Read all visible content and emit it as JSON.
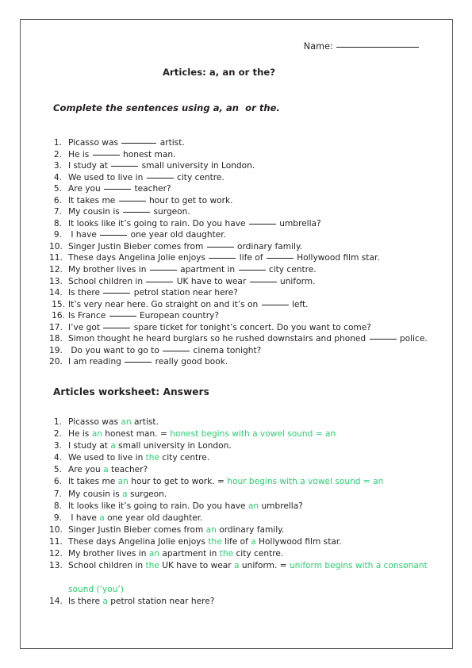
{
  "header": {
    "name_label": "Name:",
    "title": "Articles: a, an or the?",
    "instruction": "Complete the sentences using a, an  or the."
  },
  "questions": {
    "items": [
      {
        "num": "1.",
        "pre": "Picasso was ",
        "blank": "w1",
        "post": " artist."
      },
      {
        "num": "2.",
        "pre": "He is ",
        "blank": "w2",
        "post": " honest man."
      },
      {
        "num": "3.",
        "pre": "I study at ",
        "blank": "w2",
        "post": " small university in London."
      },
      {
        "num": "4.",
        "pre": "We used to live in ",
        "blank": "w2",
        "post": " city centre."
      },
      {
        "num": "5.",
        "pre": "Are you ",
        "blank": "w2",
        "post": " teacher?"
      },
      {
        "num": "6.",
        "pre": "It takes me ",
        "blank": "w2",
        "post": " hour to get to work."
      },
      {
        "num": "7.",
        "pre": "My cousin is ",
        "blank": "w2",
        "post": " surgeon."
      },
      {
        "num": "8.",
        "pre": "It looks like it’s going to rain. Do you have ",
        "blank": "w2",
        "post": " umbrella?"
      },
      {
        "num": "9.",
        "pre": " I have ",
        "blank": "w2",
        "post": " one year old daughter."
      },
      {
        "num": "10.",
        "pre": "Singer Justin Bieber comes from ",
        "blank": "w2",
        "post": " ordinary family."
      },
      {
        "num": "11.",
        "pre": "These days Angelina Jolie enjoys ",
        "blank": "w2",
        "mid": " life of ",
        "blank2": "w2",
        "post": " Hollywood film star."
      },
      {
        "num": "12.",
        "pre": "My brother lives in ",
        "blank": "w2",
        "mid": " apartment in ",
        "blank2": "w2",
        "post": " city centre."
      },
      {
        "num": "13.",
        "pre": "School children in ",
        "blank": "w2",
        "mid": " UK have to wear ",
        "blank2": "w2",
        "post": " uniform."
      },
      {
        "num": "14.",
        "pre": "Is there ",
        "blank": "w2",
        "post": " petrol station near here?"
      },
      {
        "num": "15.",
        "pre": "It’s very near here. Go straight on and it’s on ",
        "blank": "w2",
        "post": " left."
      },
      {
        "num": "16.",
        "pre": "Is France ",
        "blank": "w2",
        "post": " European country?"
      },
      {
        "num": "17.",
        "pre": "I’ve got ",
        "blank": "w2",
        "post": " spare ticket for tonight’s concert. Do you want to come?"
      },
      {
        "num": "18.",
        "pre": "Simon thought he heard burglars so he rushed downstairs and phoned ",
        "blank": "w2",
        "post": " police."
      },
      {
        "num": "19.",
        "pre": " Do you want to go to ",
        "blank": "w2",
        "post": " cinema tonight?"
      },
      {
        "num": "20.",
        "pre": "I am reading ",
        "blank": "w2",
        "post": " really good book."
      }
    ]
  },
  "answers": {
    "title": "Articles worksheet: Answers",
    "items": [
      {
        "num": "1.",
        "pre": "Picasso was ",
        "ans": "an",
        "post": " artist.",
        "note": ""
      },
      {
        "num": "2.",
        "pre": "He is ",
        "ans": "an",
        "post": " honest man. = ",
        "note": "honest begins with a vowel sound = an"
      },
      {
        "num": "3.",
        "pre": "I study at ",
        "ans": "a",
        "post": " small university in London.",
        "note": ""
      },
      {
        "num": "4.",
        "pre": "We used to live in ",
        "ans": "the",
        "post": " city centre.",
        "note": ""
      },
      {
        "num": "5.",
        "pre": "Are you ",
        "ans": "a",
        "post": " teacher?",
        "note": ""
      },
      {
        "num": "6.",
        "pre": "It takes me ",
        "ans": "an",
        "post": " hour to get to work. = ",
        "note": "hour begins with a vowel sound = an"
      },
      {
        "num": "7.",
        "pre": "My cousin is ",
        "ans": "a",
        "post": " surgeon.",
        "note": ""
      },
      {
        "num": "8.",
        "pre": "It looks like it’s going to rain. Do you have ",
        "ans": "an",
        "post": " umbrella?",
        "note": ""
      },
      {
        "num": "9.",
        "pre": " I have ",
        "ans": "a",
        "post": " one year old daughter.",
        "note": ""
      },
      {
        "num": "10.",
        "pre": "Singer Justin Bieber comes from ",
        "ans": "an",
        "post": " ordinary family.",
        "note": ""
      },
      {
        "num": "11.",
        "pre": "These days Angelina Jolie enjoys ",
        "ans": "the",
        "mid": " life of ",
        "ans2": "a",
        "post": " Hollywood film star.",
        "note": ""
      },
      {
        "num": "12.",
        "pre": "My brother lives in ",
        "ans": "an",
        "mid": " apartment in ",
        "ans2": "the",
        "post": " city centre.",
        "note": ""
      },
      {
        "num": "13.",
        "pre": "School children in ",
        "ans": "the",
        "mid": " UK have to wear ",
        "ans2": "a",
        "post": " uniform. = ",
        "note": "uniform begins with a consonant",
        "note2": "sound (‘you’)"
      },
      {
        "num": "14.",
        "pre": "Is there ",
        "ans": "a",
        "post": " petrol station near here?",
        "note": ""
      }
    ]
  },
  "colors": {
    "answer_green": "#2ecc71",
    "text": "#231f20",
    "border": "#55565c"
  }
}
